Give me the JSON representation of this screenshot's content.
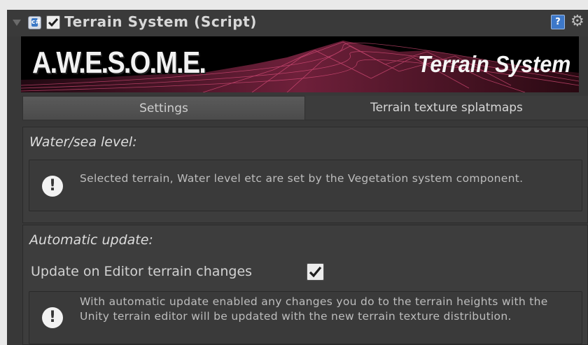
{
  "component": {
    "title": "Terrain System (Script)",
    "enabled": true,
    "script_icon": "script-icon",
    "help_icon": "?",
    "settings_icon": "gear-icon"
  },
  "banner": {
    "logo": "A.W.E.S.O.M.E.",
    "subtitle": "Terrain System"
  },
  "tabs": [
    {
      "label": "Settings",
      "active": true
    },
    {
      "label": "Terrain texture splatmaps",
      "active": false
    }
  ],
  "water_section": {
    "label": "Water/sea level:",
    "info_icon": "!",
    "info_text": "Selected terrain, Water level etc are set by the Vegetation system component."
  },
  "auto_section": {
    "label": "Automatic update:",
    "toggle_label": "Update on Editor terrain changes",
    "toggle_checked": true,
    "info_icon": "!",
    "info_text": "With automatic update enabled any changes you do to the terrain heights with the Unity terrain editor will be updated with the new terrain texture distribution."
  },
  "colors": {
    "panel_bg": "#383838",
    "text": "#d2d2d2",
    "help_blue": "#3d78c9"
  }
}
